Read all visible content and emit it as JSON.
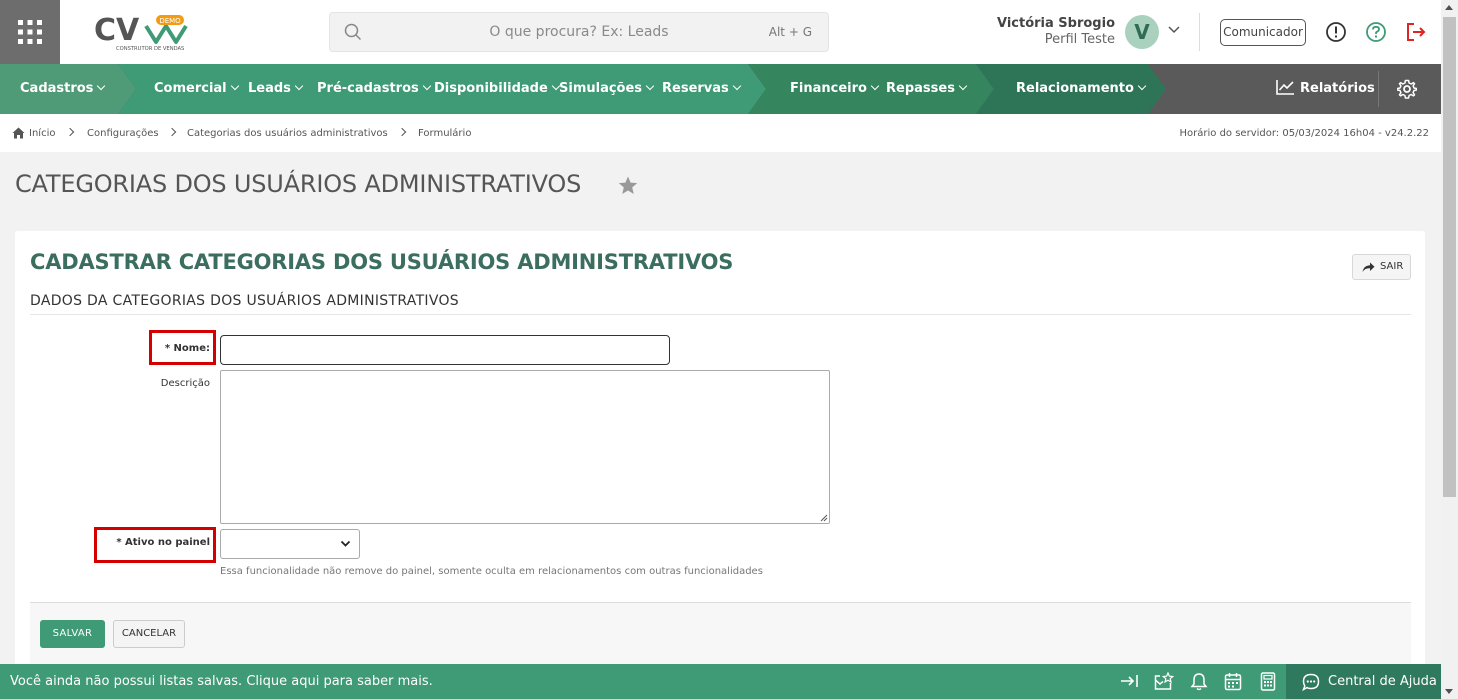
{
  "header": {
    "apps_icon": "grid-icon",
    "logo": {
      "text": "CV",
      "badge": "DEMO",
      "tagline": "CONSTRUTOR DE VENDAS"
    },
    "search": {
      "placeholder": "O que procura? Ex: Leads",
      "shortcut": "Alt + G"
    },
    "user": {
      "name": "Victória Sbrogio",
      "profile": "Perfil Teste",
      "initial": "V"
    },
    "comunicador_label": "Comunicador",
    "icons": [
      "info-icon",
      "help-icon",
      "logout-icon"
    ],
    "colors": {
      "logout": "#e02424"
    }
  },
  "nav": {
    "items": [
      {
        "label": "Cadastros"
      },
      {
        "label": "Comercial"
      },
      {
        "label": "Leads"
      },
      {
        "label": "Pré-cadastros"
      },
      {
        "label": "Disponibilidade"
      },
      {
        "label": "Simulações"
      },
      {
        "label": "Reservas"
      },
      {
        "label": "Financeiro"
      },
      {
        "label": "Repasses"
      },
      {
        "label": "Relacionamento"
      }
    ],
    "reports_label": "Relatórios",
    "colors": {
      "seg1": "#4f9b78",
      "seg2": "#3f9a76",
      "seg3": "#35855f",
      "seg4": "#2e7558",
      "base": "#5a5a5a"
    }
  },
  "breadcrumb": {
    "items": [
      "Início",
      "Configurações",
      "Categorias dos usuários administrativos",
      "Formulário"
    ],
    "server_time": "Horário do servidor: 05/03/2024 16h04 - v24.2.22"
  },
  "page": {
    "title": "CATEGORIAS DOS USUÁRIOS ADMINISTRATIVOS"
  },
  "form": {
    "title": "CADASTRAR CATEGORIAS DOS USUÁRIOS ADMINISTRATIVOS",
    "exit_label": "SAIR",
    "section_title": "DADOS DA CATEGORIAS DOS USUÁRIOS ADMINISTRATIVOS",
    "fields": {
      "nome": {
        "label": "* Nome:",
        "value": ""
      },
      "descricao": {
        "label": "Descrição",
        "value": ""
      },
      "ativo": {
        "label": "* Ativo no painel",
        "value": "",
        "help": "Essa funcionalidade não remove do painel, somente oculta em relacionamentos com outras funcionalidades"
      }
    },
    "save_label": "SALVAR",
    "cancel_label": "CANCELAR"
  },
  "footer": {
    "message": "Você ainda não possui listas salvas. Clique aqui para saber mais.",
    "icons": [
      "collapse-right-icon",
      "favorites-icon",
      "bell-icon",
      "calendar-icon",
      "calculator-icon"
    ],
    "help_center_label": "Central de Ajuda"
  }
}
